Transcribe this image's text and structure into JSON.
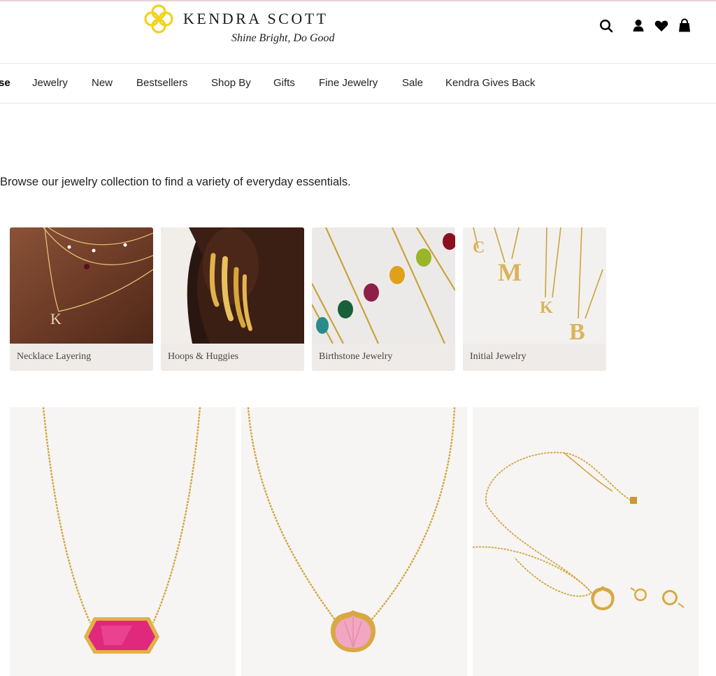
{
  "brand": {
    "name": "KENDRA SCOTT",
    "tagline": "Shine Bright, Do Good",
    "accent_color": "#f2d21c"
  },
  "header_icons": [
    "search-icon",
    "account-icon",
    "wishlist-heart-icon",
    "shopping-bag-icon"
  ],
  "nav": {
    "items": [
      {
        "label": "se"
      },
      {
        "label": "Jewelry"
      },
      {
        "label": "New"
      },
      {
        "label": "Bestsellers"
      },
      {
        "label": "Shop By"
      },
      {
        "label": "Gifts"
      },
      {
        "label": "Fine Jewelry"
      },
      {
        "label": "Sale"
      },
      {
        "label": "Kendra Gives Back"
      }
    ]
  },
  "intro_text": "Browse our jewelry collection to find a variety of everyday essentials.",
  "categories": [
    {
      "label": "Necklace Layering"
    },
    {
      "label": "Hoops & Huggies"
    },
    {
      "label": "Birthstone Jewelry"
    },
    {
      "label": "Initial Jewelry"
    }
  ],
  "products": [
    {
      "image": "gold chain necklace with magenta oval pendant",
      "stone_color": "#e0287c"
    },
    {
      "image": "gold chain necklace with pink seashell pendant",
      "stone_color": "#f2a6c2"
    },
    {
      "image": "gold necklace and stud earrings with white seashell",
      "stone_color": "#f7f1e8"
    }
  ],
  "colors": {
    "gold": "#d3a53c",
    "tile_bg": "#efebe8",
    "divider": "#e6e6e6",
    "product_bg": "#f6f5f4"
  }
}
